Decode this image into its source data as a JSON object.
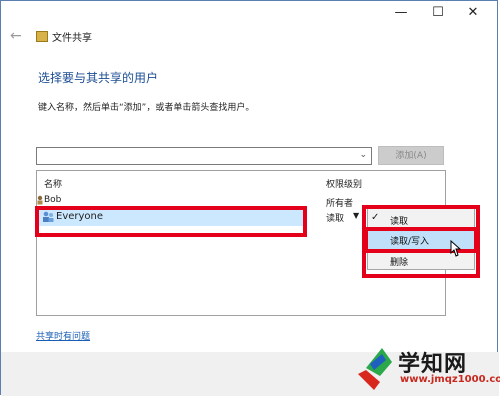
{
  "window": {
    "back_glyph": "←",
    "title": "文件共享",
    "minimize_glyph": "—",
    "maximize_glyph": "☐",
    "close_glyph": "✕"
  },
  "heading": "选择要与其共享的用户",
  "instruction": "键入名称，然后单击“添加”，或者单击箭头查找用户。",
  "combo": {
    "value": "",
    "arrow_glyph": "⌄"
  },
  "add_button": "添加(A)",
  "table": {
    "headers": [
      "名称",
      "权限级别"
    ],
    "rows": [
      {
        "name": "Bob",
        "permission": "所有者"
      },
      {
        "name": "Everyone",
        "permission": "读取"
      }
    ]
  },
  "permission_menu": {
    "items": [
      "读取",
      "读取/写入",
      "删除"
    ],
    "checked_item": "读取",
    "hovered_item": "读取/写入"
  },
  "help_link": "共享时有问题",
  "watermark": {
    "title": "学知网",
    "url": "www.jmqz1000.com"
  },
  "colors": {
    "highlight": "#e4001b",
    "heading": "#1d4e94",
    "selection": "#cce8ff",
    "link": "#1a5fb4"
  }
}
